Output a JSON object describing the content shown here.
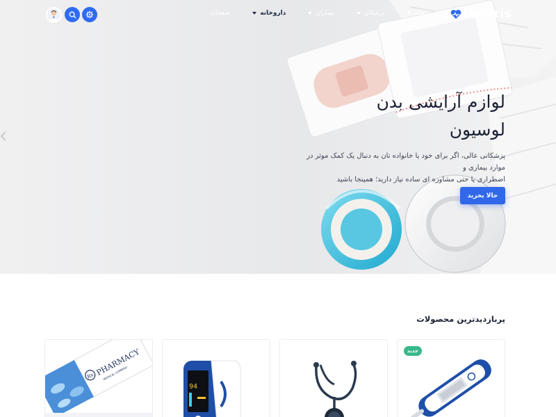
{
  "header": {
    "logo_text": "Doctris",
    "nav": [
      {
        "label": "خانه",
        "has_menu": true,
        "active": false
      },
      {
        "label": "پزشکان",
        "has_menu": true,
        "active": false
      },
      {
        "label": "بیماران",
        "has_menu": true,
        "active": false
      },
      {
        "label": "داروخانه",
        "has_menu": true,
        "active": true
      },
      {
        "label": "صفحات",
        "has_menu": false,
        "active": false
      }
    ],
    "actions": [
      "settings-icon",
      "search-icon",
      "avatar"
    ]
  },
  "hero": {
    "title_line1": "لوازم آرایشی بدن",
    "title_line2": "لوسیون",
    "description_line1": "پزشکانی عالی، اگر برای خود یا خانواده تان به دنبال یک کمک موثر در موارد بیماری و",
    "description_line2": "اضطراری یا حتی مشاوره ای ساده نیاز دارید؛ همینجا باشید",
    "cta_label": "حالا بخرید"
  },
  "products": {
    "section_title": "پربازدیدترین محصولات",
    "items": [
      {
        "image": "thermometer",
        "badge": "جدید"
      },
      {
        "image": "stethoscope",
        "badge": null
      },
      {
        "image": "pulse-oximeter",
        "badge": null,
        "screen_value": "94"
      },
      {
        "image": "pharmacy-box",
        "badge": null,
        "box_text": "PHARMACY",
        "box_sub": "MEDICAL COMPANY",
        "box_logo": "Rx"
      }
    ]
  },
  "colors": {
    "primary": "#3168ea",
    "heading": "#1b2234",
    "badge_green": "#39b98a"
  }
}
